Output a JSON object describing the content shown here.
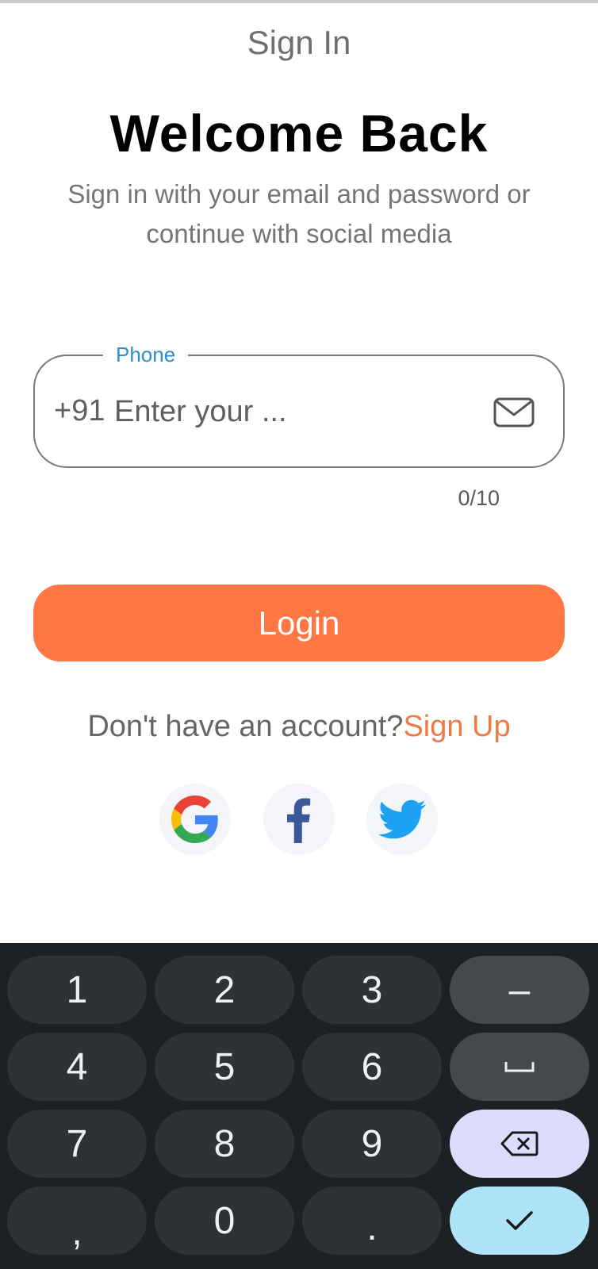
{
  "appbar": {
    "title": "Sign In"
  },
  "header": {
    "heading": "Welcome Back",
    "subtitle": "Sign in with your email and password or continue with social media"
  },
  "phone_field": {
    "label": "Phone",
    "prefix": "+91",
    "value": "",
    "placeholder": "Enter your ...",
    "counter": "0/10",
    "trailing_icon": "mail-icon"
  },
  "login": {
    "label": "Login",
    "color": "#ff7743"
  },
  "signup": {
    "prompt": "Don't have an account?",
    "link": "Sign Up",
    "link_color": "#f07a45"
  },
  "social": [
    {
      "name": "google",
      "icon": "google-icon"
    },
    {
      "name": "facebook",
      "icon": "facebook-icon"
    },
    {
      "name": "twitter",
      "icon": "twitter-icon"
    }
  ],
  "keyboard": {
    "keys": {
      "k1": "1",
      "k2": "2",
      "k3": "3",
      "minus": "–",
      "k4": "4",
      "k5": "5",
      "k6": "6",
      "space_icon": "space-icon",
      "k7": "7",
      "k8": "8",
      "k9": "9",
      "backspace_icon": "backspace-icon",
      "comma": ",",
      "k0": "0",
      "period": ".",
      "done_icon": "checkmark-icon"
    }
  }
}
